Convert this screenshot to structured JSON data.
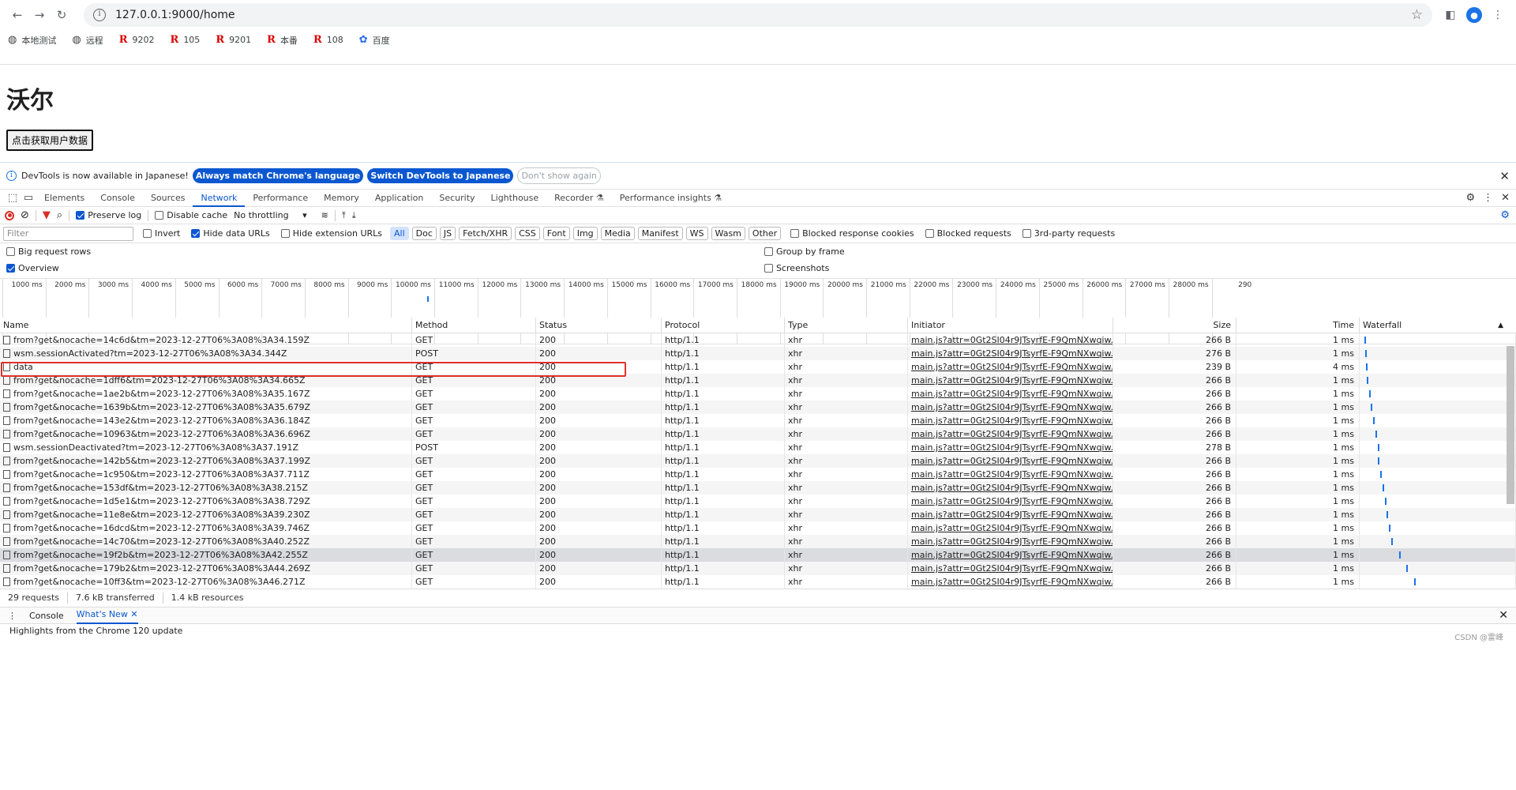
{
  "browser": {
    "url": "127.0.0.1:9000/home",
    "bookmarks": [
      {
        "icon": "globe-icon",
        "label": "本地测试"
      },
      {
        "icon": "globe-icon",
        "label": "远程"
      },
      {
        "icon": "r-logo-icon",
        "label": "9202"
      },
      {
        "icon": "r-logo-icon",
        "label": "105"
      },
      {
        "icon": "r-logo-icon",
        "label": "9201"
      },
      {
        "icon": "r-logo-icon",
        "label": "本番"
      },
      {
        "icon": "r-logo-icon",
        "label": "108"
      },
      {
        "icon": "paw-icon",
        "label": "百度"
      }
    ]
  },
  "page": {
    "heading": "沃尔",
    "button_label": "点击获取用户数据"
  },
  "devtools": {
    "infobar": {
      "message": "DevTools is now available in Japanese!",
      "btn_match": "Always match Chrome's language",
      "btn_switch": "Switch DevTools to Japanese",
      "btn_dismiss": "Don't show again"
    },
    "tabs": [
      "Elements",
      "Console",
      "Sources",
      "Network",
      "Performance",
      "Memory",
      "Application",
      "Security",
      "Lighthouse",
      "Recorder ⚗",
      "Performance insights ⚗"
    ],
    "active_tab": "Network",
    "toolbar": {
      "preserve_log": "Preserve log",
      "disable_cache": "Disable cache",
      "throttling": "No throttling"
    },
    "filter": {
      "placeholder": "Filter",
      "invert": "Invert",
      "hide_data_urls": "Hide data URLs",
      "hide_ext_urls": "Hide extension URLs",
      "types": [
        "All",
        "Doc",
        "JS",
        "Fetch/XHR",
        "CSS",
        "Font",
        "Img",
        "Media",
        "Manifest",
        "WS",
        "Wasm",
        "Other"
      ],
      "blocked_cookies": "Blocked response cookies",
      "blocked_requests": "Blocked requests",
      "third_party": "3rd-party requests"
    },
    "options": {
      "big_rows": "Big request rows",
      "group_by_frame": "Group by frame",
      "overview": "Overview",
      "screenshots": "Screenshots"
    },
    "overview_ticks": [
      "1000 ms",
      "2000 ms",
      "3000 ms",
      "4000 ms",
      "5000 ms",
      "6000 ms",
      "7000 ms",
      "8000 ms",
      "9000 ms",
      "10000 ms",
      "11000 ms",
      "12000 ms",
      "13000 ms",
      "14000 ms",
      "15000 ms",
      "16000 ms",
      "17000 ms",
      "18000 ms",
      "19000 ms",
      "20000 ms",
      "21000 ms",
      "22000 ms",
      "23000 ms",
      "24000 ms",
      "25000 ms",
      "26000 ms",
      "27000 ms",
      "28000 ms",
      "290"
    ],
    "columns": [
      "Name",
      "Method",
      "Status",
      "Protocol",
      "Type",
      "Initiator",
      "Size",
      "Time",
      "Waterfall"
    ],
    "initiator": "main.js?attr=0Gt2SI04r9JTsyrfE-F9QmNXwqiw...",
    "rows": [
      {
        "name": "from?get&nocache=14c6d&tm=2023-12-27T06%3A08%3A34.159Z",
        "method": "GET",
        "status": "200",
        "protocol": "http/1.1",
        "type": "xhr",
        "size": "266 B",
        "time": "1 ms",
        "wf": 0.012
      },
      {
        "name": "wsm.sessionActivated?tm=2023-12-27T06%3A08%3A34.344Z",
        "method": "POST",
        "status": "200",
        "protocol": "http/1.1",
        "type": "xhr",
        "size": "276 B",
        "time": "1 ms",
        "wf": 0.016
      },
      {
        "name": "data",
        "method": "GET",
        "status": "200",
        "protocol": "http/1.1",
        "type": "xhr",
        "size": "239 B",
        "time": "4 ms",
        "wf": 0.02
      },
      {
        "name": "from?get&nocache=1dff6&tm=2023-12-27T06%3A08%3A34.665Z",
        "method": "GET",
        "status": "200",
        "protocol": "http/1.1",
        "type": "xhr",
        "size": "266 B",
        "time": "1 ms",
        "wf": 0.025
      },
      {
        "name": "from?get&nocache=1ae2b&tm=2023-12-27T06%3A08%3A35.167Z",
        "method": "GET",
        "status": "200",
        "protocol": "http/1.1",
        "type": "xhr",
        "size": "266 B",
        "time": "1 ms",
        "wf": 0.04
      },
      {
        "name": "from?get&nocache=1639b&tm=2023-12-27T06%3A08%3A35.679Z",
        "method": "GET",
        "status": "200",
        "protocol": "http/1.1",
        "type": "xhr",
        "size": "266 B",
        "time": "1 ms",
        "wf": 0.055
      },
      {
        "name": "from?get&nocache=143e2&tm=2023-12-27T06%3A08%3A36.184Z",
        "method": "GET",
        "status": "200",
        "protocol": "http/1.1",
        "type": "xhr",
        "size": "266 B",
        "time": "1 ms",
        "wf": 0.07
      },
      {
        "name": "from?get&nocache=10963&tm=2023-12-27T06%3A08%3A36.696Z",
        "method": "GET",
        "status": "200",
        "protocol": "http/1.1",
        "type": "xhr",
        "size": "266 B",
        "time": "1 ms",
        "wf": 0.085
      },
      {
        "name": "wsm.sessionDeactivated?tm=2023-12-27T06%3A08%3A37.191Z",
        "method": "POST",
        "status": "200",
        "protocol": "http/1.1",
        "type": "xhr",
        "size": "278 B",
        "time": "1 ms",
        "wf": 0.1
      },
      {
        "name": "from?get&nocache=142b5&tm=2023-12-27T06%3A08%3A37.199Z",
        "method": "GET",
        "status": "200",
        "protocol": "http/1.1",
        "type": "xhr",
        "size": "266 B",
        "time": "1 ms",
        "wf": 0.1
      },
      {
        "name": "from?get&nocache=1c950&tm=2023-12-27T06%3A08%3A37.711Z",
        "method": "GET",
        "status": "200",
        "protocol": "http/1.1",
        "type": "xhr",
        "size": "266 B",
        "time": "1 ms",
        "wf": 0.115
      },
      {
        "name": "from?get&nocache=153df&tm=2023-12-27T06%3A08%3A38.215Z",
        "method": "GET",
        "status": "200",
        "protocol": "http/1.1",
        "type": "xhr",
        "size": "266 B",
        "time": "1 ms",
        "wf": 0.13
      },
      {
        "name": "from?get&nocache=1d5e1&tm=2023-12-27T06%3A08%3A38.729Z",
        "method": "GET",
        "status": "200",
        "protocol": "http/1.1",
        "type": "xhr",
        "size": "266 B",
        "time": "1 ms",
        "wf": 0.145
      },
      {
        "name": "from?get&nocache=11e8e&tm=2023-12-27T06%3A08%3A39.230Z",
        "method": "GET",
        "status": "200",
        "protocol": "http/1.1",
        "type": "xhr",
        "size": "266 B",
        "time": "1 ms",
        "wf": 0.16
      },
      {
        "name": "from?get&nocache=16dcd&tm=2023-12-27T06%3A08%3A39.746Z",
        "method": "GET",
        "status": "200",
        "protocol": "http/1.1",
        "type": "xhr",
        "size": "266 B",
        "time": "1 ms",
        "wf": 0.175
      },
      {
        "name": "from?get&nocache=14c70&tm=2023-12-27T06%3A08%3A40.252Z",
        "method": "GET",
        "status": "200",
        "protocol": "http/1.1",
        "type": "xhr",
        "size": "266 B",
        "time": "1 ms",
        "wf": 0.19
      },
      {
        "name": "from?get&nocache=19f2b&tm=2023-12-27T06%3A08%3A42.255Z",
        "method": "GET",
        "status": "200",
        "protocol": "http/1.1",
        "type": "xhr",
        "size": "266 B",
        "time": "1 ms",
        "wf": 0.24
      },
      {
        "name": "from?get&nocache=179b2&tm=2023-12-27T06%3A08%3A44.269Z",
        "method": "GET",
        "status": "200",
        "protocol": "http/1.1",
        "type": "xhr",
        "size": "266 B",
        "time": "1 ms",
        "wf": 0.29
      },
      {
        "name": "from?get&nocache=10ff3&tm=2023-12-27T06%3A08%3A46.271Z",
        "method": "GET",
        "status": "200",
        "protocol": "http/1.1",
        "type": "xhr",
        "size": "266 B",
        "time": "1 ms",
        "wf": 0.34
      }
    ],
    "summary": {
      "requests": "29 requests",
      "transferred": "7.6 kB transferred",
      "resources": "1.4 kB resources"
    },
    "drawer": {
      "tab_console": "Console",
      "tab_whats_new": "What's New",
      "content": "Highlights from the Chrome 120 update"
    },
    "watermark": "CSDN @雷峰"
  }
}
